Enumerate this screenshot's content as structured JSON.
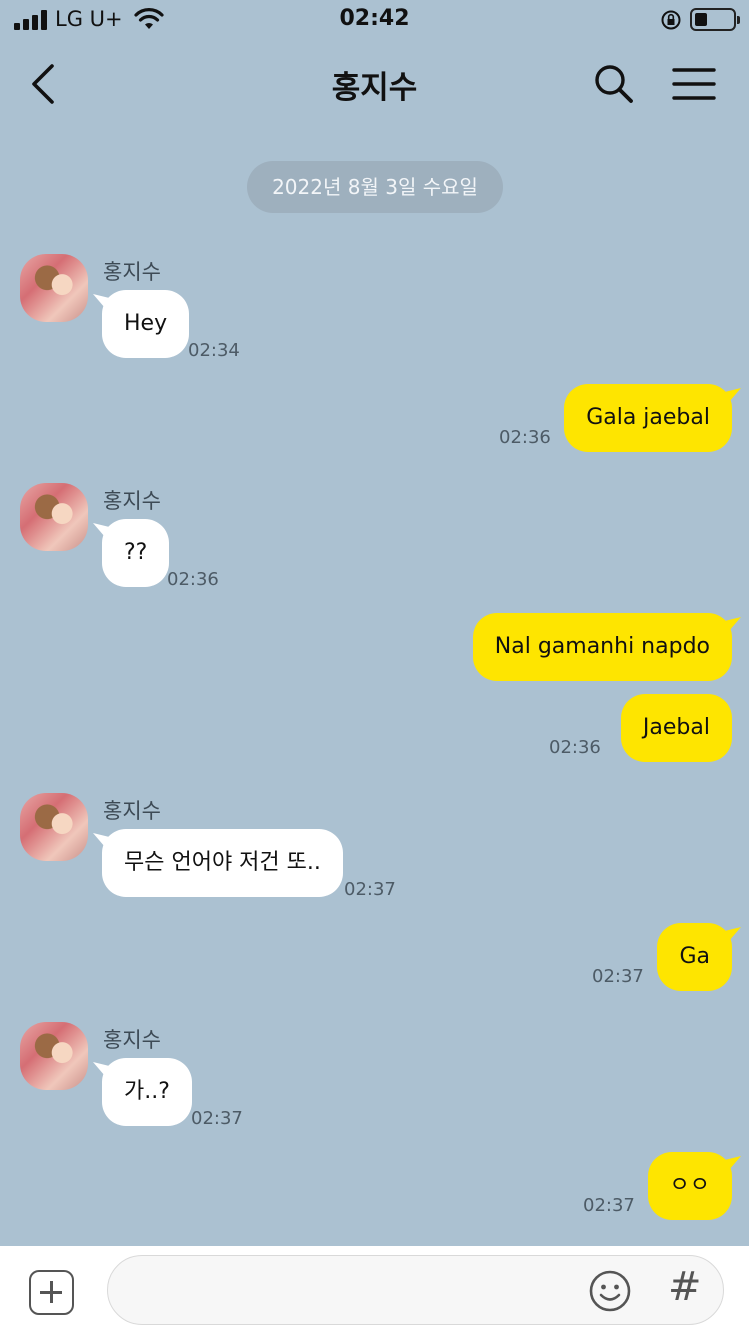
{
  "status_bar": {
    "carrier": "LG U+",
    "time": "02:42"
  },
  "header": {
    "title": "홍지수"
  },
  "date_divider": "2022년 8월 3일 수요일",
  "contact_name": "홍지수",
  "messages": [
    {
      "side": "in",
      "text": "Hey",
      "time": "02:34"
    },
    {
      "side": "out",
      "text": "Gala jaebal",
      "time": "02:36"
    },
    {
      "side": "in",
      "text": "??",
      "time": "02:36"
    },
    {
      "side": "out",
      "text": "Nal gamanhi napdo",
      "time": ""
    },
    {
      "side": "out",
      "text": "Jaebal",
      "time": "02:36"
    },
    {
      "side": "in",
      "text": "무슨 언어야 저건 또..",
      "time": "02:37"
    },
    {
      "side": "out",
      "text": "Ga",
      "time": "02:37"
    },
    {
      "side": "in",
      "text": "가..?",
      "time": "02:37"
    },
    {
      "side": "out",
      "text": "ㅇㅇ",
      "time": "02:37"
    }
  ],
  "input": {
    "placeholder": ""
  },
  "icons": {
    "hash": "#"
  },
  "colors": {
    "background": "#abc1d1",
    "outgoing_bubble": "#fee500",
    "incoming_bubble": "#ffffff"
  }
}
